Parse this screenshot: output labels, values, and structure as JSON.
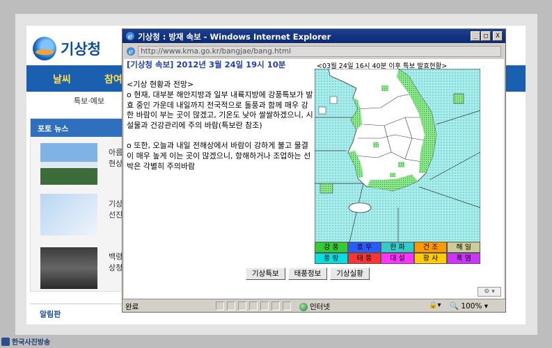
{
  "colors": {
    "titlebar": "#0b2a72",
    "headline": "#1f3fb0",
    "sea": "#a8ecec",
    "land": "#ffffff",
    "warning_zone": "#8ce68c"
  },
  "background_page": {
    "logo_text": "기상청",
    "nav_items": [
      "날씨",
      "참여"
    ],
    "subnav": "특보·예보",
    "photo_news_title": "포토 뉴스",
    "photo_items": [
      "아름다\n현상으",
      "기상\n선진",
      "백령\n상청"
    ],
    "board_title": "알림판"
  },
  "watermark": "한국사진방송",
  "ie_window": {
    "title": "기상청 : 방재 속보 - Windows Internet Explorer",
    "window_controls": [
      "_",
      "□",
      "X"
    ],
    "address": "http://www.kma.go.kr/bangjae/bang.html",
    "icons": [
      "ie-logo-icon",
      "page-icon",
      "globe-icon",
      "lock-icon",
      "zoom-icon"
    ]
  },
  "bulletin": {
    "headline": "[기상청 속보] 2012년 3월 24일 19시 10분",
    "section_title": "<기상 현황과 전망>",
    "paragraph1": "o 현재, 대부분 해안지방과 일부 내륙지방에 강풍특보가 발효 중인 가운데 내일까지 전국적으로 돌풍과 함께 매우 강한 바람이 부는 곳이 많겠고, 기온도 낮아 쌀쌀하겠으니, 시설물과 건강관리에 주의 바람(특보란 참조)",
    "paragraph2": "o 또한, 오늘과 내일 전해상에서 바람이 강하게 불고 물결이 매우 높게 이는 곳이 많겠으니, 항해하거나 조업하는 선박은 각별히 주의바람"
  },
  "map": {
    "caption": "<03월 24일 16시 40분 이후 특보 발효현황>"
  },
  "legend": [
    [
      {
        "label": "강 풍",
        "color": "#33cc33"
      },
      {
        "label": "호 우",
        "color": "#2a5bff"
      },
      {
        "label": "한 파",
        "color": "#33cccc"
      },
      {
        "label": "건 조",
        "color": "#ff9900"
      },
      {
        "label": "해 일",
        "color": "#cccc99"
      }
    ],
    [
      {
        "label": "풍 랑",
        "color": "#00e0e0"
      },
      {
        "label": "태 풍",
        "color": "#ff3333"
      },
      {
        "label": "대 설",
        "color": "#ff33ff"
      },
      {
        "label": "황 사",
        "color": "#ffcc00"
      },
      {
        "label": "폭 염",
        "color": "#cc33ff"
      }
    ]
  ],
  "buttons": [
    "기상특보",
    "태풍정보",
    "기상실황"
  ],
  "statusbar": {
    "done": "완료",
    "zone": "인터넷",
    "zoom": "100%"
  }
}
